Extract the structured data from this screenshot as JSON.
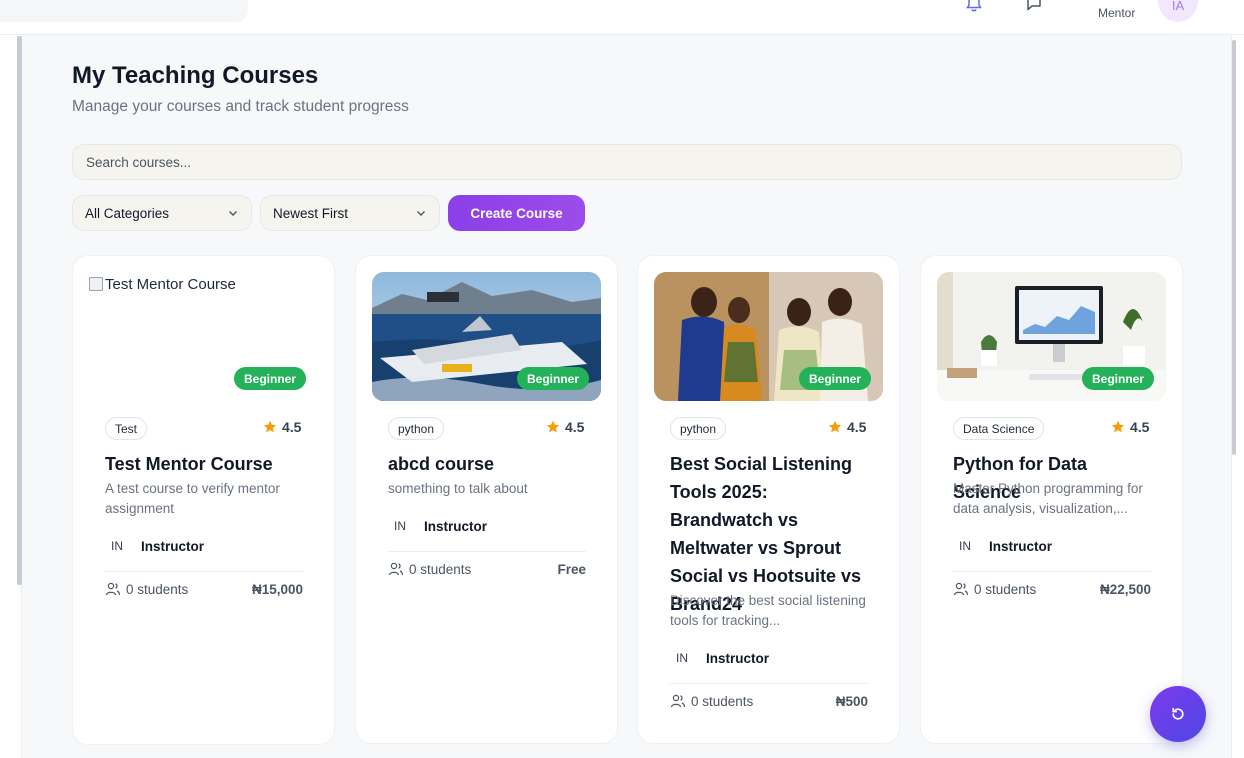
{
  "header": {
    "role": "Mentor",
    "avatar_initials": "IA",
    "icons": [
      "bell-icon",
      "chat-icon"
    ]
  },
  "page": {
    "title": "My Teaching Courses",
    "subtitle": "Manage your courses and track student progress"
  },
  "search": {
    "placeholder": "Search courses..."
  },
  "filters": {
    "category": "All Categories",
    "sort": "Newest First",
    "create_label": "Create Course"
  },
  "colors": {
    "accent": "#8b3fe8",
    "badge_green": "#23b25a",
    "star": "#f59e0b"
  },
  "courses": [
    {
      "image_alt": "Test Mentor Course",
      "level": "Beginner",
      "category": "Test",
      "rating": "4.5",
      "title": "Test Mentor Course",
      "description": "A test course to verify mentor assignment",
      "instructor_initials": "IN",
      "instructor": "Instructor",
      "students": "0 students",
      "price": "₦15,000"
    },
    {
      "image_alt": "ship at sea",
      "level": "Beginner",
      "category": "python",
      "rating": "4.5",
      "title": "abcd course",
      "description": "something to talk about",
      "instructor_initials": "IN",
      "instructor": "Instructor",
      "students": "0 students",
      "price": "Free"
    },
    {
      "image_alt": "two couples photo",
      "level": "Beginner",
      "category": "python",
      "rating": "4.5",
      "title": "Best Social Listening Tools 2025: Brandwatch vs Meltwater vs Sprout Social vs Hootsuite vs Brand24",
      "description": "Discover the best social listening tools for tracking...",
      "instructor_initials": "IN",
      "instructor": "Instructor",
      "students": "0 students",
      "price": "₦500"
    },
    {
      "image_alt": "desk with monitor",
      "level": "Beginner",
      "category": "Data Science",
      "rating": "4.5",
      "title": "Python for Data Science",
      "description": "Master Python programming for data analysis, visualization,...",
      "instructor_initials": "IN",
      "instructor": "Instructor",
      "students": "0 students",
      "price": "₦22,500"
    }
  ]
}
